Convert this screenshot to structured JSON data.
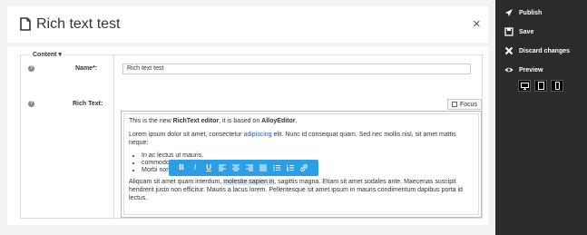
{
  "window": {
    "title": "Rich text test",
    "close_label": "×"
  },
  "form": {
    "legend": "Content ▾",
    "name_label": "Name*:",
    "name_value": "Rich text test",
    "richtext_label": "Rich Text:",
    "focus_label": "Focus"
  },
  "editor": {
    "p1_a": "This is the new ",
    "p1_b": "RichText editor",
    "p1_c": ", it is based on ",
    "p1_d": "AlloyEditor",
    "p1_e": ".",
    "p2_a": "Lorem ipsum dolor sit amet, consectetur ",
    "p2_link": "adipiscing",
    "p2_b": " elit. Nunc id consequat quam. Sed nec mollis nisl, sit amet mattis neque:",
    "list": [
      "In ac lectus ut mauris.",
      "commodo",
      "Morbi non"
    ],
    "p3_a": "Aliquam sit amet quam interdum, ",
    "p3_hl": "molestie sapien in",
    "p3_b": ", sagittis magna. Etiam sit amet sodales ante. Maecenas suscipit hendrerit justo non efficitur. Mauris a lacus lorem. Pellentesque sit amet ipsum in mauris condimentum dapibus porta id lectus."
  },
  "toolbar": {
    "buttons": [
      "bold",
      "italic",
      "underline",
      "align-left",
      "align-center",
      "align-right",
      "align-justify",
      "unordered-list",
      "ordered-list",
      "link"
    ],
    "bold": "B",
    "italic": "I",
    "underline": "U"
  },
  "sidebar": {
    "publish": "Publish",
    "save": "Save",
    "discard": "Discard changes",
    "preview": "Preview",
    "preview_modes": [
      "desktop",
      "tablet",
      "mobile"
    ]
  },
  "colors": {
    "toolbar_bg": "#2b9ee6",
    "sidebar_bg": "#2b2b2b",
    "link": "#1c5fb0"
  }
}
